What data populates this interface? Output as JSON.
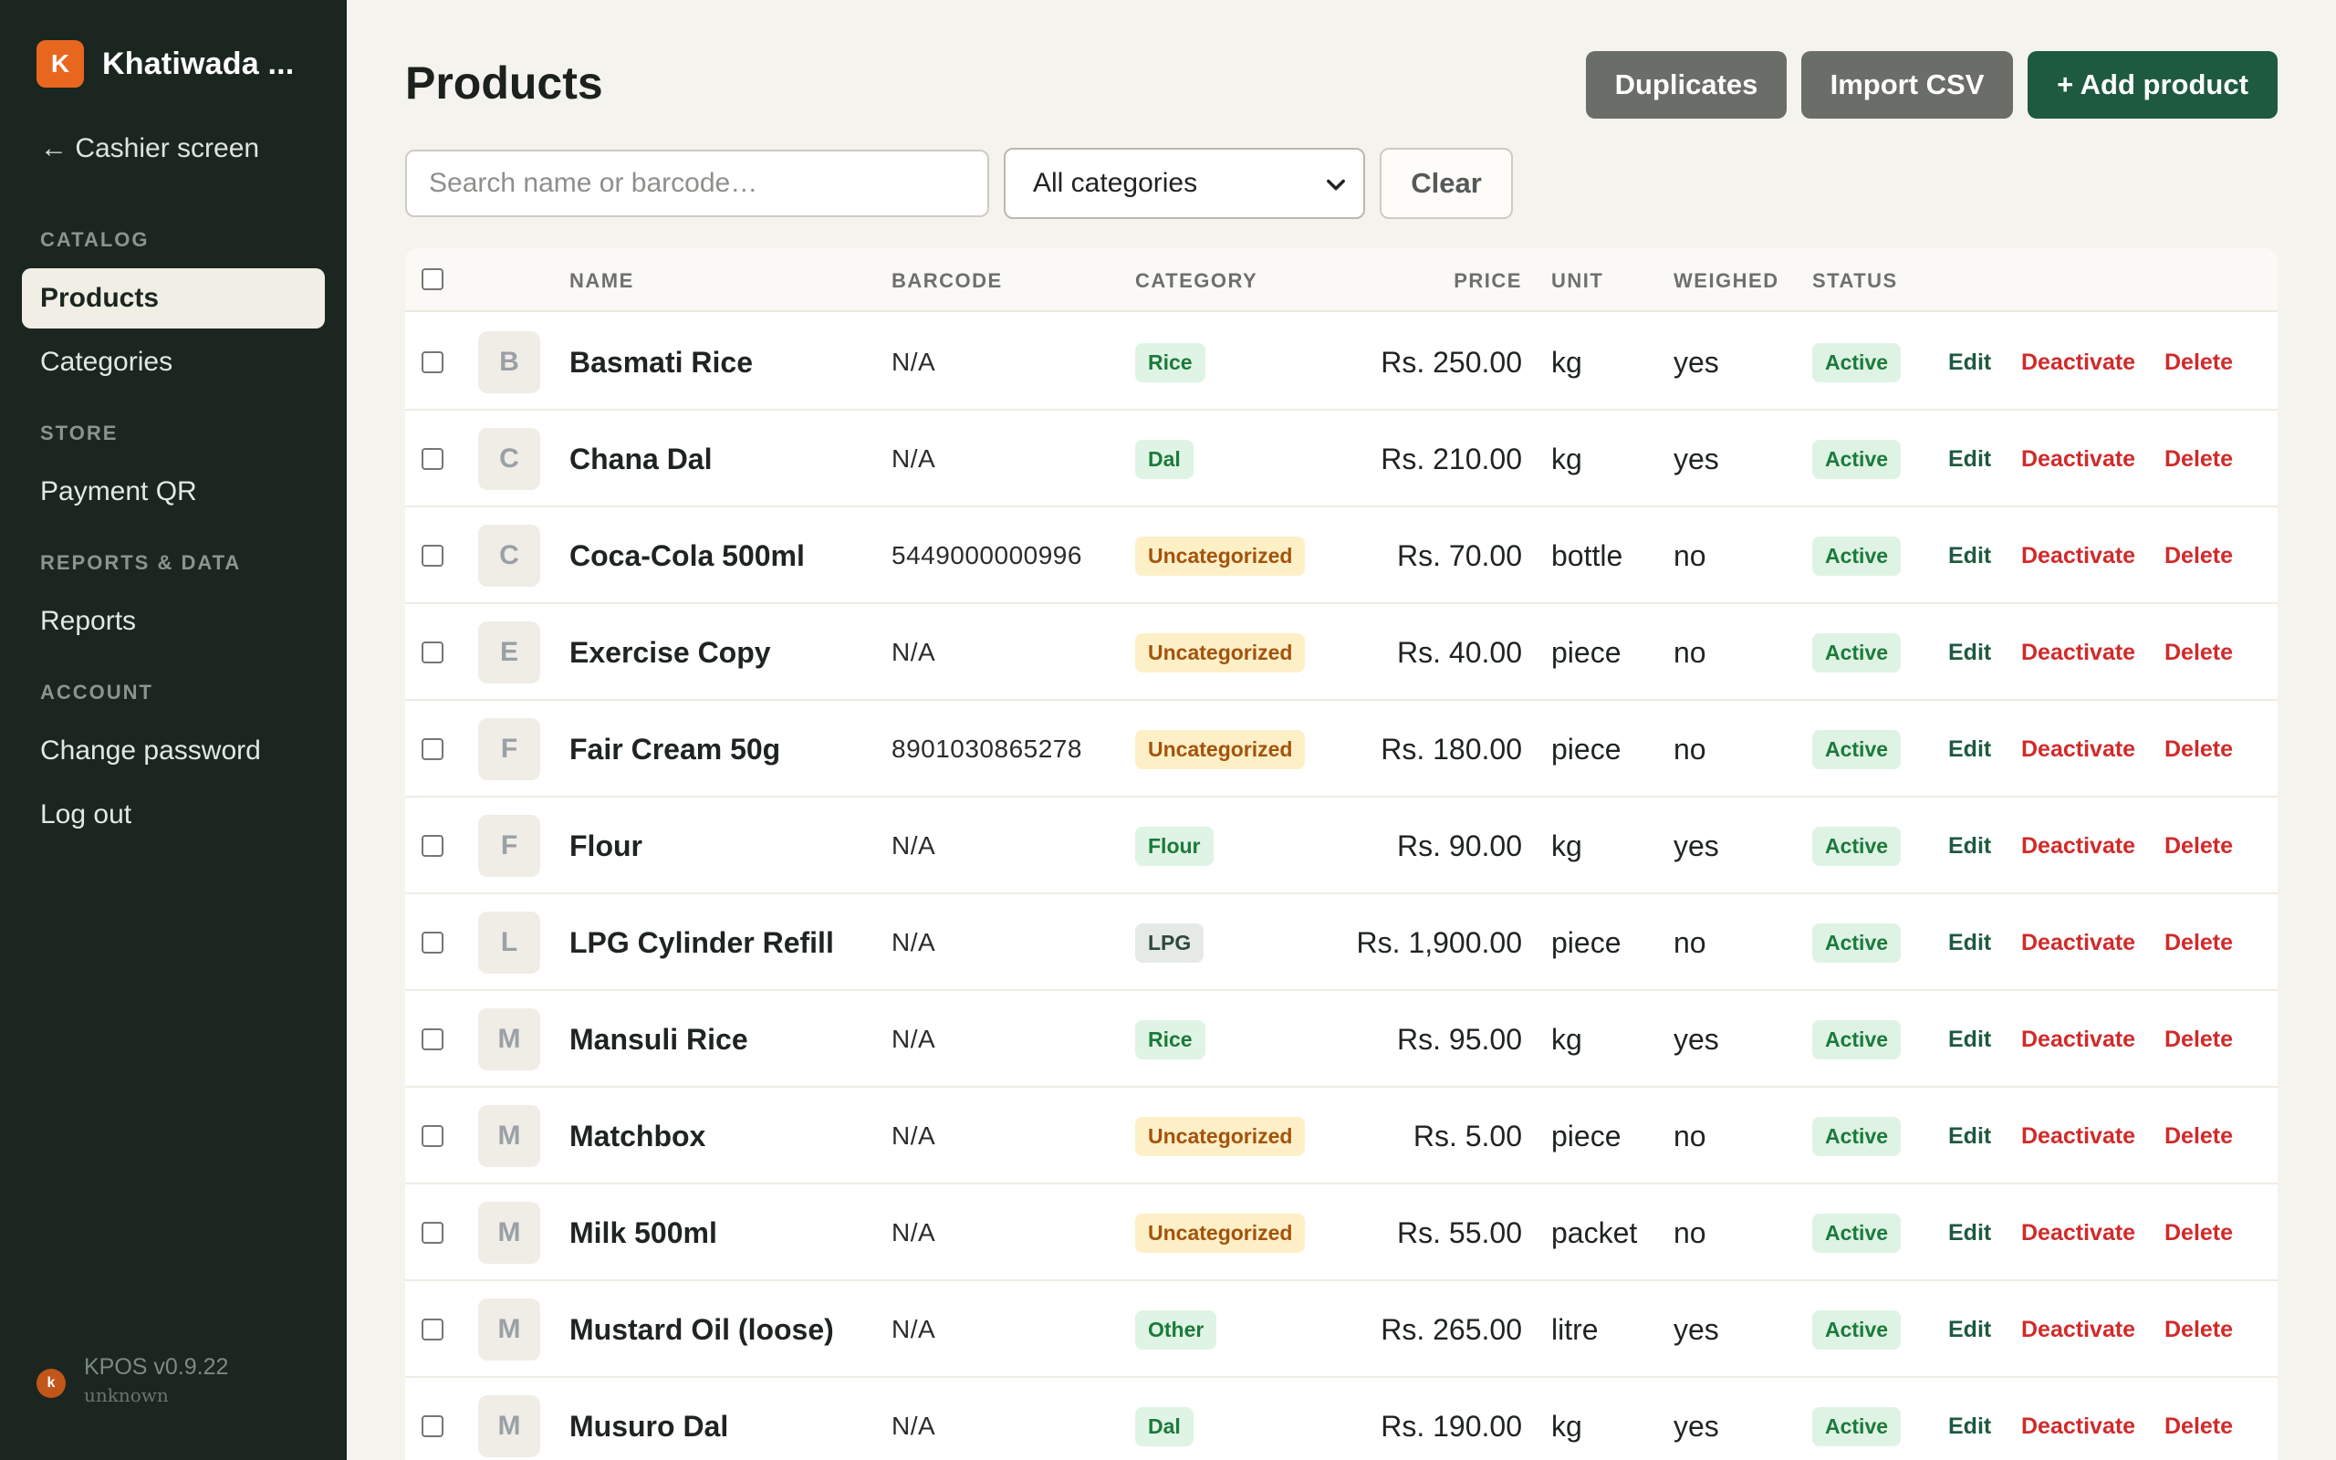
{
  "sidebar": {
    "brand_letter": "K",
    "brand_name": "Khatiwada ...",
    "cashier_link": "← Cashier screen",
    "sections": {
      "catalog": "CATALOG",
      "store": "STORE",
      "reports_data": "REPORTS & DATA",
      "account": "ACCOUNT"
    },
    "items": {
      "products": "Products",
      "categories": "Categories",
      "payment_qr": "Payment QR",
      "reports": "Reports",
      "change_password": "Change password",
      "log_out": "Log out"
    },
    "version": {
      "badge": "k",
      "name": "KPOS v0.9.22",
      "sub": "unknown"
    }
  },
  "header": {
    "title": "Products",
    "duplicates_label": "Duplicates",
    "import_label": "Import CSV",
    "add_label": "+ Add product"
  },
  "filters": {
    "search_placeholder": "Search name or barcode…",
    "category_selected": "All categories",
    "clear_label": "Clear"
  },
  "table": {
    "columns": {
      "name": "NAME",
      "barcode": "BARCODE",
      "category": "CATEGORY",
      "price": "PRICE",
      "unit": "UNIT",
      "weighed": "WEIGHED",
      "status": "STATUS"
    },
    "actions": {
      "edit": "Edit",
      "deactivate": "Deactivate",
      "delete": "Delete"
    },
    "rows": [
      {
        "initial": "B",
        "name": "Basmati Rice",
        "barcode": "N/A",
        "category": "Rice",
        "category_style": "green",
        "price": "Rs. 250.00",
        "unit": "kg",
        "weighed": "yes",
        "status": "Active"
      },
      {
        "initial": "C",
        "name": "Chana Dal",
        "barcode": "N/A",
        "category": "Dal",
        "category_style": "green",
        "price": "Rs. 210.00",
        "unit": "kg",
        "weighed": "yes",
        "status": "Active"
      },
      {
        "initial": "C",
        "name": "Coca-Cola 500ml",
        "barcode": "5449000000996",
        "category": "Uncategorized",
        "category_style": "yellow",
        "price": "Rs. 70.00",
        "unit": "bottle",
        "weighed": "no",
        "status": "Active"
      },
      {
        "initial": "E",
        "name": "Exercise Copy",
        "barcode": "N/A",
        "category": "Uncategorized",
        "category_style": "yellow",
        "price": "Rs. 40.00",
        "unit": "piece",
        "weighed": "no",
        "status": "Active"
      },
      {
        "initial": "F",
        "name": "Fair Cream 50g",
        "barcode": "8901030865278",
        "category": "Uncategorized",
        "category_style": "yellow",
        "price": "Rs. 180.00",
        "unit": "piece",
        "weighed": "no",
        "status": "Active"
      },
      {
        "initial": "F",
        "name": "Flour",
        "barcode": "N/A",
        "category": "Flour",
        "category_style": "green",
        "price": "Rs. 90.00",
        "unit": "kg",
        "weighed": "yes",
        "status": "Active"
      },
      {
        "initial": "L",
        "name": "LPG Cylinder Refill",
        "barcode": "N/A",
        "category": "LPG",
        "category_style": "grey",
        "price": "Rs. 1,900.00",
        "unit": "piece",
        "weighed": "no",
        "status": "Active"
      },
      {
        "initial": "M",
        "name": "Mansuli Rice",
        "barcode": "N/A",
        "category": "Rice",
        "category_style": "green",
        "price": "Rs. 95.00",
        "unit": "kg",
        "weighed": "yes",
        "status": "Active"
      },
      {
        "initial": "M",
        "name": "Matchbox",
        "barcode": "N/A",
        "category": "Uncategorized",
        "category_style": "yellow",
        "price": "Rs. 5.00",
        "unit": "piece",
        "weighed": "no",
        "status": "Active"
      },
      {
        "initial": "M",
        "name": "Milk 500ml",
        "barcode": "N/A",
        "category": "Uncategorized",
        "category_style": "yellow",
        "price": "Rs. 55.00",
        "unit": "packet",
        "weighed": "no",
        "status": "Active"
      },
      {
        "initial": "M",
        "name": "Mustard Oil (loose)",
        "barcode": "N/A",
        "category": "Other",
        "category_style": "green",
        "price": "Rs. 265.00",
        "unit": "litre",
        "weighed": "yes",
        "status": "Active"
      },
      {
        "initial": "M",
        "name": "Musuro Dal",
        "barcode": "N/A",
        "category": "Dal",
        "category_style": "green",
        "price": "Rs. 190.00",
        "unit": "kg",
        "weighed": "yes",
        "status": "Active"
      }
    ]
  },
  "colors": {
    "sidebar_bg": "#1b2620",
    "brand_accent": "#e8671f",
    "primary_button": "#1e5a3f",
    "secondary_button": "#6b6e68",
    "danger": "#d12a2a",
    "page_bg": "#f5f3ed"
  },
  "icons": {
    "brand": "brand-logo-icon",
    "select_chevron": "chevron-down-icon",
    "back_arrow": "arrow-left-icon"
  }
}
